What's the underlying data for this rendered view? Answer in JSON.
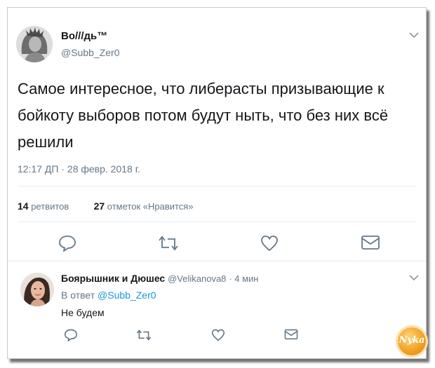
{
  "tweet": {
    "author_name": "Во///дь™",
    "author_handle": "@Subb_Zer0",
    "text": "Самое интересное, что либерасты призывающие к бойкоту выборов потом будут ныть, что без них всё решили",
    "timestamp": "12:17 ДП · 28 февр. 2018 г.",
    "retweets_count": "14",
    "retweets_label": "ретвитов",
    "likes_count": "27",
    "likes_label": "отметок «Нравится»"
  },
  "reply": {
    "author_name": "Боярышник и Дюшес",
    "author_handle": "@Velikanova8",
    "time": "· 4 мин",
    "in_reply_prefix": "В ответ",
    "in_reply_handle": "@Subb_Zer0",
    "text": "Не будем"
  },
  "watermark": "Nyka",
  "icons": {
    "caret": "chevron-down-icon",
    "reply": "reply-icon",
    "retweet": "retweet-icon",
    "like": "heart-icon",
    "dm": "envelope-icon"
  },
  "colors": {
    "text": "#14171a",
    "secondary": "#657786",
    "link": "#1b95e0",
    "icon": "#657786",
    "divider": "#e6ecf0"
  }
}
